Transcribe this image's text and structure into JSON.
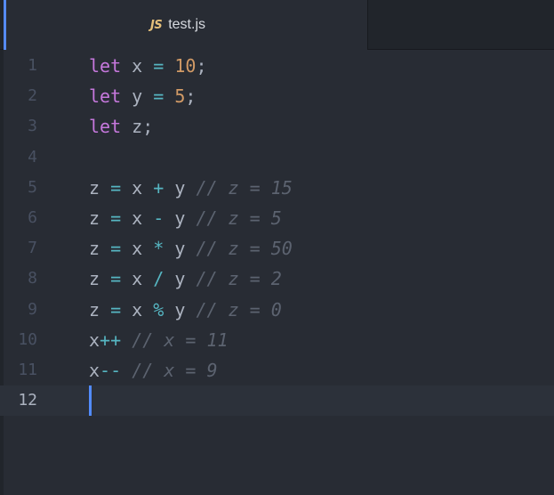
{
  "tab": {
    "icon_label": "JS",
    "title": "test.js"
  },
  "colors": {
    "keyword": "#c678dd",
    "number": "#d19a66",
    "operator": "#56b6c2",
    "comment": "#5c6370",
    "cursor": "#528bff",
    "background": "#282c34"
  },
  "lines": [
    {
      "num": "1",
      "tokens": [
        {
          "t": "let",
          "c": "kw"
        },
        {
          "t": " x ",
          "c": "var"
        },
        {
          "t": "=",
          "c": "op"
        },
        {
          "t": " ",
          "c": "var"
        },
        {
          "t": "10",
          "c": "num"
        },
        {
          "t": ";",
          "c": "punc"
        }
      ]
    },
    {
      "num": "2",
      "tokens": [
        {
          "t": "let",
          "c": "kw"
        },
        {
          "t": " y ",
          "c": "var"
        },
        {
          "t": "=",
          "c": "op"
        },
        {
          "t": " ",
          "c": "var"
        },
        {
          "t": "5",
          "c": "num"
        },
        {
          "t": ";",
          "c": "punc"
        }
      ]
    },
    {
      "num": "3",
      "tokens": [
        {
          "t": "let",
          "c": "kw"
        },
        {
          "t": " z;",
          "c": "var"
        }
      ]
    },
    {
      "num": "4",
      "tokens": []
    },
    {
      "num": "5",
      "tokens": [
        {
          "t": "z ",
          "c": "var"
        },
        {
          "t": "=",
          "c": "op"
        },
        {
          "t": " x ",
          "c": "var"
        },
        {
          "t": "+",
          "c": "op"
        },
        {
          "t": " y ",
          "c": "var"
        },
        {
          "t": "// z = 15",
          "c": "cmt"
        }
      ]
    },
    {
      "num": "6",
      "tokens": [
        {
          "t": "z ",
          "c": "var"
        },
        {
          "t": "=",
          "c": "op"
        },
        {
          "t": " x ",
          "c": "var"
        },
        {
          "t": "-",
          "c": "op"
        },
        {
          "t": " y ",
          "c": "var"
        },
        {
          "t": "// z = 5",
          "c": "cmt"
        }
      ]
    },
    {
      "num": "7",
      "tokens": [
        {
          "t": "z ",
          "c": "var"
        },
        {
          "t": "=",
          "c": "op"
        },
        {
          "t": " x ",
          "c": "var"
        },
        {
          "t": "*",
          "c": "op"
        },
        {
          "t": " y ",
          "c": "var"
        },
        {
          "t": "// z = 50",
          "c": "cmt"
        }
      ]
    },
    {
      "num": "8",
      "tokens": [
        {
          "t": "z ",
          "c": "var"
        },
        {
          "t": "=",
          "c": "op"
        },
        {
          "t": " x ",
          "c": "var"
        },
        {
          "t": "/",
          "c": "op"
        },
        {
          "t": " y ",
          "c": "var"
        },
        {
          "t": "// z = 2",
          "c": "cmt"
        }
      ]
    },
    {
      "num": "9",
      "tokens": [
        {
          "t": "z ",
          "c": "var"
        },
        {
          "t": "=",
          "c": "op"
        },
        {
          "t": " x ",
          "c": "var"
        },
        {
          "t": "%",
          "c": "op"
        },
        {
          "t": " y ",
          "c": "var"
        },
        {
          "t": "// z = 0",
          "c": "cmt"
        }
      ]
    },
    {
      "num": "10",
      "tokens": [
        {
          "t": "x",
          "c": "var"
        },
        {
          "t": "++",
          "c": "op"
        },
        {
          "t": " ",
          "c": "var"
        },
        {
          "t": "// x = 11",
          "c": "cmt"
        }
      ]
    },
    {
      "num": "11",
      "tokens": [
        {
          "t": "x",
          "c": "var"
        },
        {
          "t": "--",
          "c": "op"
        },
        {
          "t": " ",
          "c": "var"
        },
        {
          "t": "// x = 9",
          "c": "cmt"
        }
      ]
    },
    {
      "num": "12",
      "tokens": [],
      "current": true
    }
  ]
}
